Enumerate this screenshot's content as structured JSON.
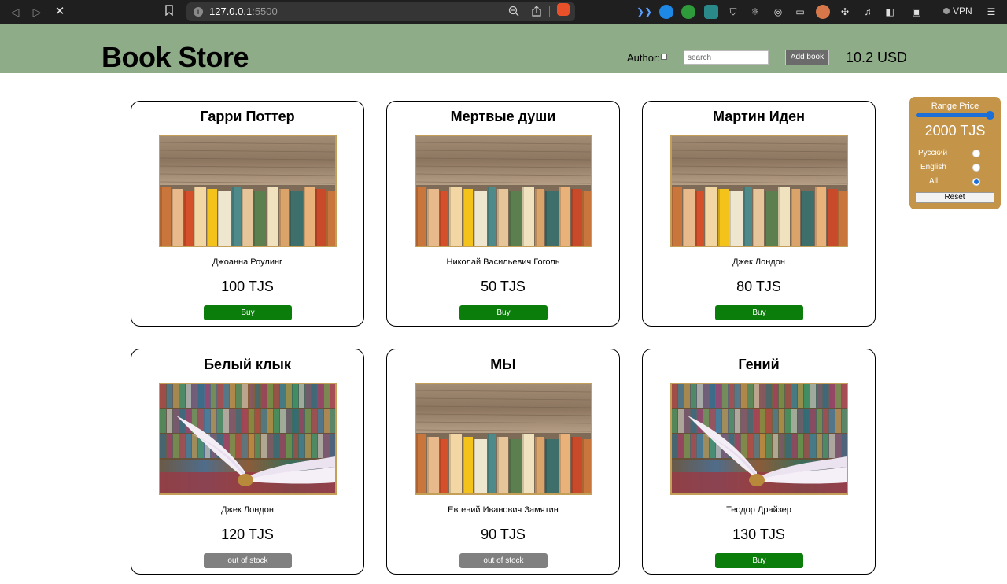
{
  "browser": {
    "url_host": "127.0.0.1",
    "url_port": ":5500",
    "vpn_label": "VPN"
  },
  "header": {
    "title": "Book Store",
    "author_label": "Author:",
    "search_placeholder": "search",
    "add_book_label": "Add book",
    "balance": "10.2 USD",
    "background_color": "#8fac89"
  },
  "books": [
    {
      "title": "Гарри Поттер",
      "author": "Джоанна Роулинг",
      "price": "100 TJS",
      "button": "Buy",
      "in_stock": true,
      "image": "books-on-shelf"
    },
    {
      "title": "Мертвые души",
      "author": "Николай Васильевич Гоголь",
      "price": "50 TJS",
      "button": "Buy",
      "in_stock": true,
      "image": "books-on-shelf"
    },
    {
      "title": "Мартин Иден",
      "author": "Джек Лондон",
      "price": "80 TJS",
      "button": "Buy",
      "in_stock": true,
      "image": "books-on-shelf"
    },
    {
      "title": "Белый клык",
      "author": "Джек Лондон",
      "price": "120 TJS",
      "button": "out of stock",
      "in_stock": false,
      "image": "open-book-library"
    },
    {
      "title": "МЫ",
      "author": "Евгений Иванович Замятин",
      "price": "90 TJS",
      "button": "out of stock",
      "in_stock": false,
      "image": "books-on-shelf"
    },
    {
      "title": "Гений",
      "author": "Теодор Драйзер",
      "price": "130 TJS",
      "button": "Buy",
      "in_stock": true,
      "image": "open-book-library"
    }
  ],
  "filter": {
    "title": "Range Price",
    "range_fill": 1.0,
    "value": "2000 TJS",
    "languages": [
      {
        "label": "Русский",
        "checked": false
      },
      {
        "label": "English",
        "checked": false
      },
      {
        "label": "All",
        "checked": true
      }
    ],
    "reset_label": "Reset",
    "panel_color": "#c49448"
  },
  "colors": {
    "buy": "#0a7d0a",
    "out_of_stock": "#808080",
    "accent": "#1b6fd6"
  }
}
